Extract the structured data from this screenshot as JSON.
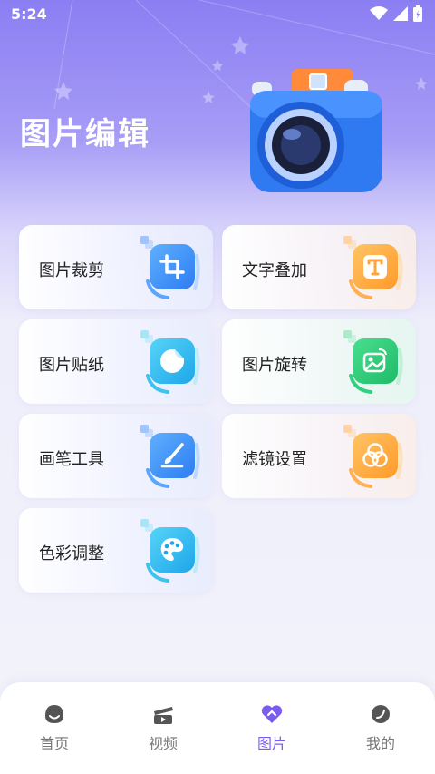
{
  "status_bar": {
    "time": "5:24"
  },
  "page": {
    "title": "图片编辑"
  },
  "tools": [
    {
      "label": "图片裁剪",
      "icon": "crop-icon"
    },
    {
      "label": "文字叠加",
      "icon": "text-icon"
    },
    {
      "label": "图片贴纸",
      "icon": "sticker-icon"
    },
    {
      "label": "图片旋转",
      "icon": "rotate-image-icon"
    },
    {
      "label": "画笔工具",
      "icon": "brush-icon"
    },
    {
      "label": "滤镜设置",
      "icon": "filter-icon"
    },
    {
      "label": "色彩调整",
      "icon": "palette-icon"
    }
  ],
  "tabbar": {
    "items": [
      {
        "label": "首页",
        "icon": "home-icon"
      },
      {
        "label": "视频",
        "icon": "video-icon"
      },
      {
        "label": "图片",
        "icon": "image-icon",
        "active": true
      },
      {
        "label": "我的",
        "icon": "profile-icon"
      }
    ]
  },
  "colors": {
    "accent": "#7a5cf0",
    "blue": "#3a8ef6",
    "orange": "#ffa63a",
    "green": "#2fd17a",
    "cyan": "#29b6f0"
  }
}
